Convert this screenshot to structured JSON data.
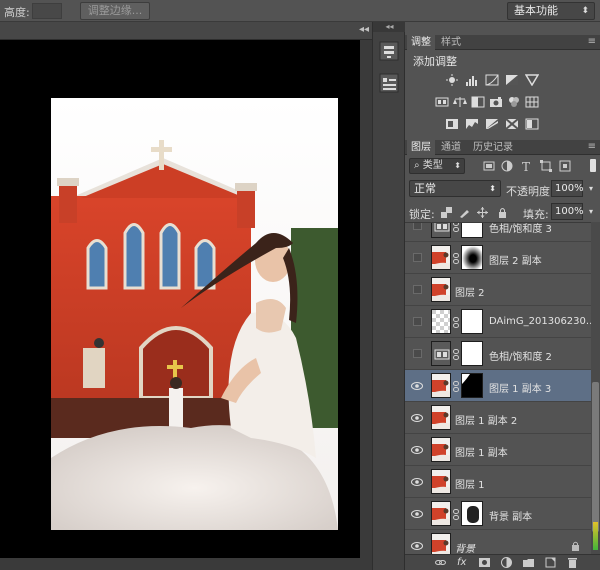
{
  "options_bar": {
    "height_label": "高度:",
    "refine_edge_label": "调整边缘...",
    "workspace_value": "基本功能"
  },
  "panels": {
    "adjustments": {
      "tabs": [
        {
          "label": "调整"
        },
        {
          "label": "样式"
        }
      ],
      "title": "添加调整",
      "row1_icons": [
        "brightness-contrast-icon",
        "levels-icon",
        "curves-icon",
        "exposure-icon",
        "vibrance-icon"
      ],
      "row2_icons": [
        "hue-saturation-icon",
        "color-balance-icon",
        "black-white-icon",
        "photo-filter-icon",
        "channel-mixer-icon",
        "color-lookup-icon"
      ],
      "row3_icons": [
        "invert-icon",
        "posterize-icon",
        "threshold-icon",
        "selective-color-icon",
        "gradient-map-icon"
      ]
    },
    "layers": {
      "tabs": [
        {
          "label": "图层"
        },
        {
          "label": "通道"
        },
        {
          "label": "历史记录"
        }
      ],
      "filter_value": "类型",
      "blend_mode": "正常",
      "opacity_label": "不透明度:",
      "opacity_value": "100%",
      "lock_label": "锁定:",
      "fill_label": "填充:",
      "fill_value": "100%",
      "items": [
        {
          "name": "色相/饱和度 3",
          "visible": false,
          "thumb": "adjustment",
          "mask": "white"
        },
        {
          "name": "图层 2 副本",
          "visible": false,
          "thumb": "photo",
          "mask": "vignette"
        },
        {
          "name": "图层 2",
          "visible": false,
          "thumb": "photo",
          "mask": ""
        },
        {
          "name": "DAimG_201306230...",
          "visible": false,
          "thumb": "transparent",
          "mask": "white"
        },
        {
          "name": "色相/饱和度 2",
          "visible": false,
          "thumb": "adjustment",
          "mask": "white"
        },
        {
          "name": "图层 1 副本 3",
          "visible": true,
          "thumb": "photo",
          "mask": "dark-corner",
          "selected": true
        },
        {
          "name": "图层 1 副本 2",
          "visible": true,
          "thumb": "photo",
          "mask": ""
        },
        {
          "name": "图层 1 副本",
          "visible": true,
          "thumb": "photo",
          "mask": ""
        },
        {
          "name": "图层 1",
          "visible": true,
          "thumb": "photo",
          "mask": ""
        },
        {
          "name": "背景 副本",
          "visible": true,
          "thumb": "photo",
          "mask": "blur"
        },
        {
          "name": "背景",
          "visible": true,
          "thumb": "photo",
          "mask": "",
          "locked": true
        }
      ],
      "footer_fx": "fx"
    }
  }
}
